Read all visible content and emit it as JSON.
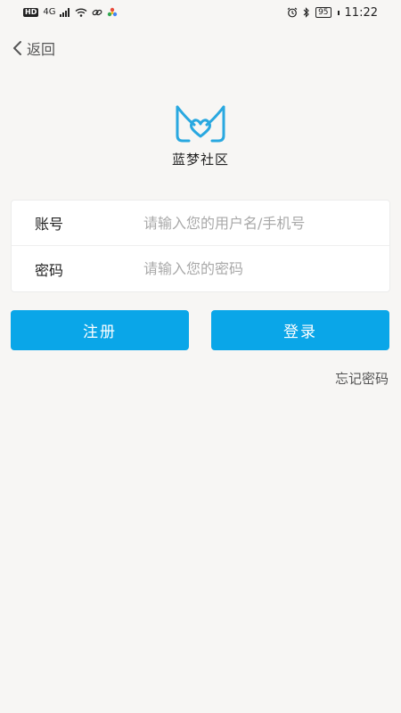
{
  "status_bar": {
    "hd": "HD",
    "signal_type": "4G",
    "battery_level": "95",
    "time": "11:22",
    "icons": [
      "signal-icon",
      "wifi-icon",
      "link-icon",
      "app-notification-icon",
      "alarm-icon",
      "bluetooth-icon",
      "battery-icon"
    ]
  },
  "header": {
    "back_label": "返回"
  },
  "app": {
    "name": "蓝梦社区"
  },
  "form": {
    "account_label": "账号",
    "account_placeholder": "请输入您的用户名/手机号",
    "account_value": "",
    "password_label": "密码",
    "password_placeholder": "请输入您的密码",
    "password_value": ""
  },
  "buttons": {
    "register_label": "注册",
    "login_label": "登录",
    "forgot_label": "忘记密码"
  },
  "colors": {
    "accent": "#0aa6e8",
    "background": "#f7f6f4",
    "logo": "#29a8e0"
  }
}
